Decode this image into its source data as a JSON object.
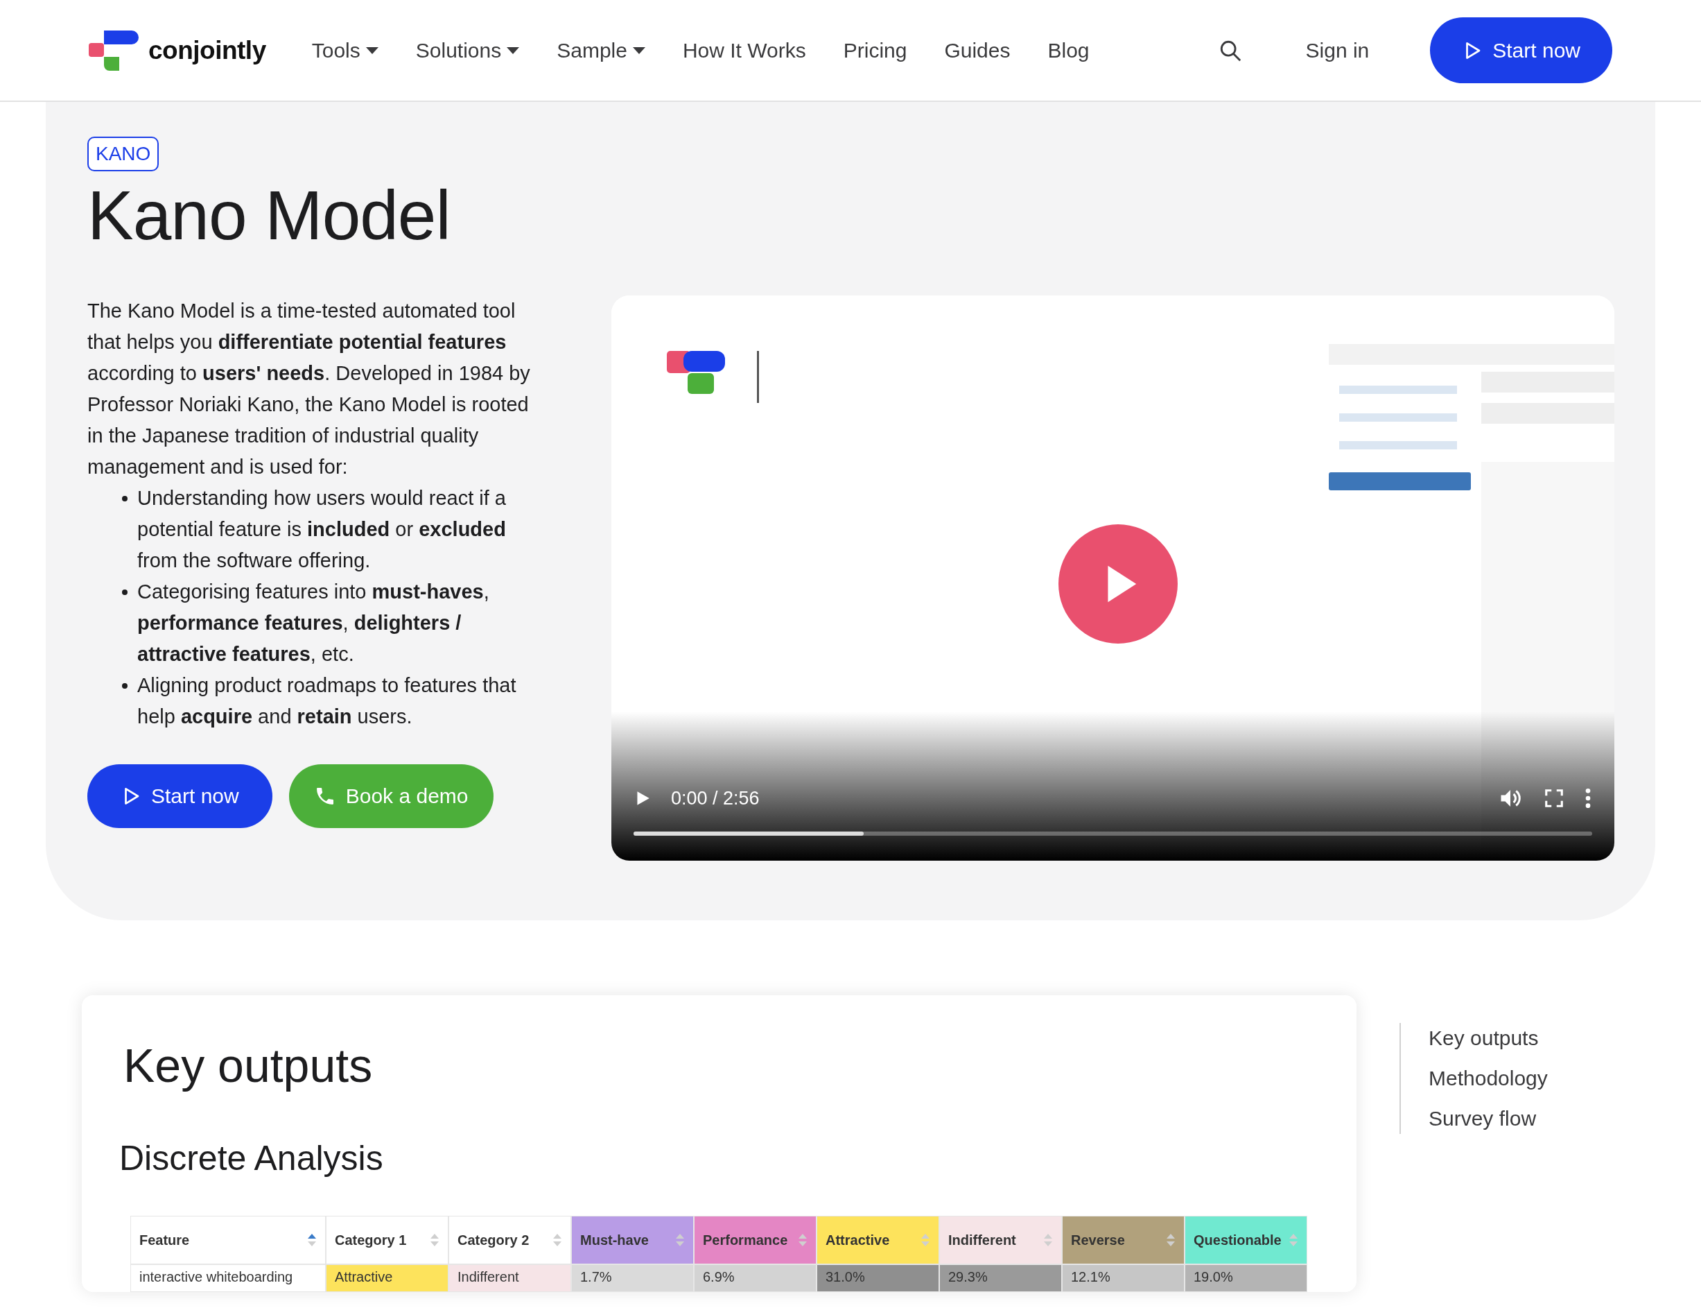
{
  "header": {
    "brand": "conjointly",
    "nav": [
      {
        "label": "Tools",
        "dropdown": true
      },
      {
        "label": "Solutions",
        "dropdown": true
      },
      {
        "label": "Sample",
        "dropdown": true
      },
      {
        "label": "How It Works",
        "dropdown": false
      },
      {
        "label": "Pricing",
        "dropdown": false
      },
      {
        "label": "Guides",
        "dropdown": false
      },
      {
        "label": "Blog",
        "dropdown": false
      }
    ],
    "sign_in": "Sign in",
    "cta": "Start now"
  },
  "hero": {
    "badge": "KANO",
    "title": "Kano Model",
    "intro": "The Kano Model is a time-tested automated tool that helps you **differentiate potential features** according to **users' needs**. Developed in 1984 by Professor Noriaki Kano, the Kano Model is rooted in the Japanese tradition of industrial quality management and is used for:",
    "bullets": [
      "Understanding how users would react if a potential feature is **included** or **excluded** from the software offering.",
      "Categorising features into **must-haves**, **performance features**, **delighters / attractive features**, etc.",
      "Aligning product roadmaps to features that help **acquire** and **retain** users."
    ],
    "buttons": [
      {
        "kind": "start",
        "label": "Start now"
      },
      {
        "kind": "demo",
        "label": "Book a demo"
      }
    ],
    "video": {
      "kind": "picture",
      "time": "0:00 / 2:56",
      "progress": {
        "level": 0.24
      },
      "playing": false
    }
  },
  "section": {
    "title": "Key outputs",
    "subtitle": "Discrete Analysis",
    "table": {
      "columns": [
        {
          "label": "Feature",
          "color": "#ffffff",
          "sorted": true
        },
        {
          "label": "Category 1",
          "color": "#ffffff",
          "sorted": false
        },
        {
          "label": "Category 2",
          "color": "#ffffff",
          "sorted": false
        },
        {
          "label": "Must-have",
          "color": "#b89ce6",
          "sorted": false
        },
        {
          "label": "Performance",
          "color": "#e486c4",
          "sorted": false
        },
        {
          "label": "Attractive",
          "color": "#fde35c",
          "sorted": false
        },
        {
          "label": "Indifferent",
          "color": "#f6e4e7",
          "sorted": false
        },
        {
          "label": "Reverse",
          "color": "#b1a17c",
          "sorted": false
        },
        {
          "label": "Questionable",
          "color": "#70e9d0",
          "sorted": false
        }
      ],
      "rows": [
        [
          {
            "text": "interactive whiteboarding",
            "color": "#ffffff"
          },
          {
            "text": "Attractive",
            "color": "#fde35c"
          },
          {
            "text": "Indifferent",
            "color": "#f6e4e7"
          },
          {
            "text": "1.7%",
            "color": "#dadada"
          },
          {
            "text": "6.9%",
            "color": "#d3d3d3"
          },
          {
            "text": "31.0%",
            "color": "#8f8f8f"
          },
          {
            "text": "29.3%",
            "color": "#9a9a9a"
          },
          {
            "text": "12.1%",
            "color": "#c6c6c6"
          },
          {
            "text": "19.0%",
            "color": "#b4b4b4"
          }
        ]
      ]
    }
  },
  "toc": [
    {
      "label": "Key outputs"
    },
    {
      "label": "Methodology"
    },
    {
      "label": "Survey flow"
    }
  ]
}
